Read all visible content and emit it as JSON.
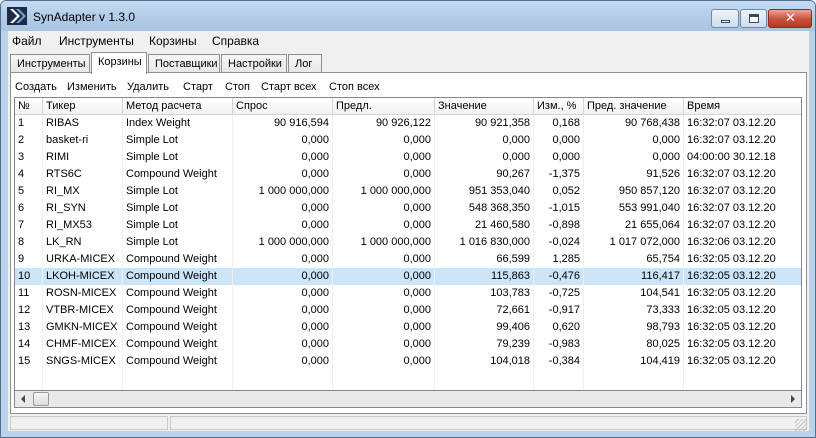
{
  "window": {
    "title": "SynAdapter v 1.3.0"
  },
  "menu": [
    "Файл",
    "Инструменты",
    "Корзины",
    "Справка"
  ],
  "tabs": [
    "Инструменты",
    "Корзины",
    "Поставщики",
    "Настройки",
    "Лог"
  ],
  "active_tab": "Корзины",
  "toolbar": [
    "Создать",
    "Изменить",
    "Удалить",
    "Старт",
    "Стоп",
    "Старт всех",
    "Стоп всех"
  ],
  "grid": {
    "columns": [
      "№",
      "Тикер",
      "Метод расчета",
      "Спрос",
      "Предл.",
      "Значение",
      "Изм., %",
      "Пред. значение",
      "Время"
    ],
    "rows": [
      [
        "1",
        "RIBAS",
        "Index Weight",
        "90 916,594",
        "90 926,122",
        "90 921,358",
        "0,168",
        "90 768,438",
        "16:32:07 03.12.20"
      ],
      [
        "2",
        "basket-ri",
        "Simple Lot",
        "0,000",
        "0,000",
        "0,000",
        "0,000",
        "0,000",
        "16:32:07 03.12.20"
      ],
      [
        "3",
        "RIMI",
        "Simple Lot",
        "0,000",
        "0,000",
        "0,000",
        "0,000",
        "0,000",
        "04:00:00 30.12.18"
      ],
      [
        "4",
        "RTS6C",
        "Compound Weight",
        "0,000",
        "0,000",
        "90,267",
        "-1,375",
        "91,526",
        "16:32:07 03.12.20"
      ],
      [
        "5",
        "RI_MX",
        "Simple Lot",
        "1 000 000,000",
        "1 000 000,000",
        "951 353,040",
        "0,052",
        "950 857,120",
        "16:32:07 03.12.20"
      ],
      [
        "6",
        "RI_SYN",
        "Simple Lot",
        "0,000",
        "0,000",
        "548 368,350",
        "-1,015",
        "553 991,040",
        "16:32:07 03.12.20"
      ],
      [
        "7",
        "RI_MX53",
        "Simple Lot",
        "0,000",
        "0,000",
        "21 460,580",
        "-0,898",
        "21 655,064",
        "16:32:07 03.12.20"
      ],
      [
        "8",
        "LK_RN",
        "Simple Lot",
        "1 000 000,000",
        "1 000 000,000",
        "1 016 830,000",
        "-0,024",
        "1 017 072,000",
        "16:32:06 03.12.20"
      ],
      [
        "9",
        "URKA-MICEX",
        "Compound Weight",
        "0,000",
        "0,000",
        "66,599",
        "1,285",
        "65,754",
        "16:32:05 03.12.20"
      ],
      [
        "10",
        "LKOH-MICEX",
        "Compound Weight",
        "0,000",
        "0,000",
        "115,863",
        "-0,476",
        "116,417",
        "16:32:05 03.12.20"
      ],
      [
        "11",
        "ROSN-MICEX",
        "Compound Weight",
        "0,000",
        "0,000",
        "103,783",
        "-0,725",
        "104,541",
        "16:32:05 03.12.20"
      ],
      [
        "12",
        "VTBR-MICEX",
        "Compound Weight",
        "0,000",
        "0,000",
        "72,661",
        "-0,917",
        "73,333",
        "16:32:05 03.12.20"
      ],
      [
        "13",
        "GMKN-MICEX",
        "Compound Weight",
        "0,000",
        "0,000",
        "99,406",
        "0,620",
        "98,793",
        "16:32:05 03.12.20"
      ],
      [
        "14",
        "CHMF-MICEX",
        "Compound Weight",
        "0,000",
        "0,000",
        "79,239",
        "-0,983",
        "80,025",
        "16:32:05 03.12.20"
      ],
      [
        "15",
        "SNGS-MICEX",
        "Compound Weight",
        "0,000",
        "0,000",
        "104,018",
        "-0,384",
        "104,419",
        "16:32:05 03.12.20"
      ]
    ],
    "selected_row": 10
  },
  "colors": {
    "selection": "#cce4f7",
    "titlebar": "#bcd2ea",
    "close": "#c9563f"
  }
}
